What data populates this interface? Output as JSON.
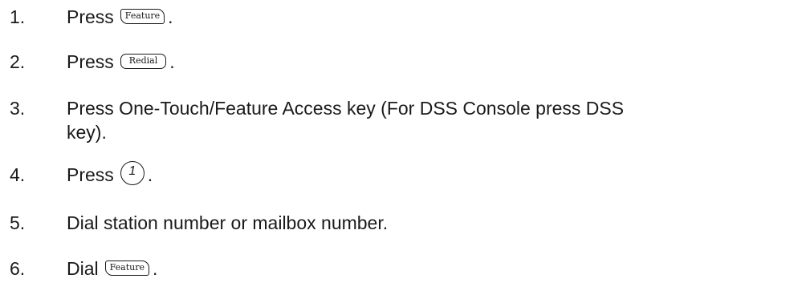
{
  "steps": [
    {
      "number": "1.",
      "prefix": "Press",
      "key": "Feature",
      "suffix": "."
    },
    {
      "number": "2.",
      "prefix": "Press",
      "key": "Redial",
      "suffix": "."
    },
    {
      "number": "3.",
      "line1": "Press One-Touch/Feature Access key (For DSS Console press DSS",
      "line2": "key)."
    },
    {
      "number": "4.",
      "prefix": "Press",
      "key": "1",
      "suffix": "."
    },
    {
      "number": "5.",
      "text": "Dial station number or mailbox number."
    },
    {
      "number": "6.",
      "prefix": "Dial",
      "key": "Feature",
      "suffix": "."
    }
  ]
}
